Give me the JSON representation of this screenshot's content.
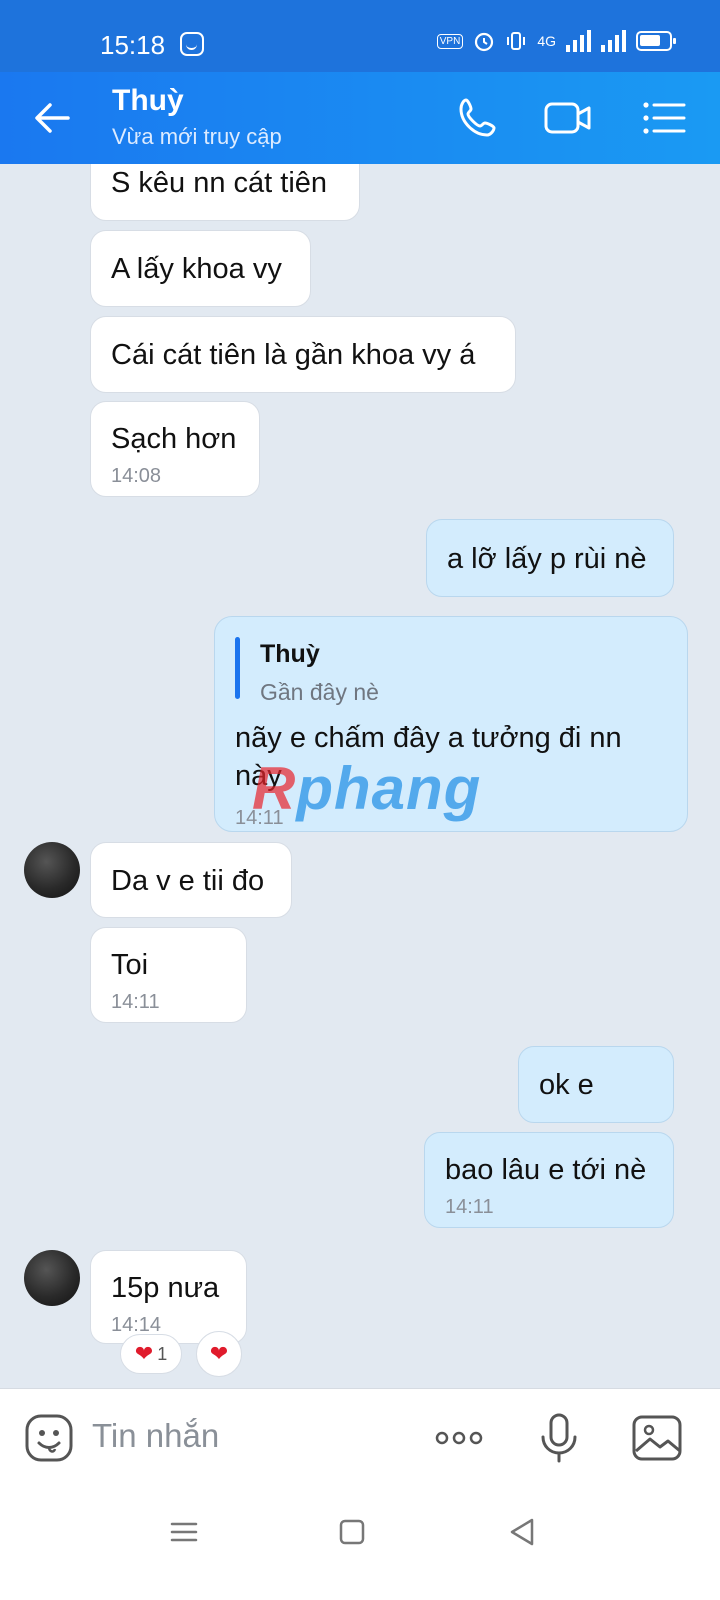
{
  "status_bar": {
    "time": "15:18",
    "network": "4G",
    "vpn": "VPN"
  },
  "header": {
    "contact_name": "Thuỳ",
    "contact_status": "Vừa mới truy cập"
  },
  "messages": [
    {
      "side": "in",
      "text": "S kêu nn cát tiên"
    },
    {
      "side": "in",
      "text": "A lấy khoa vy"
    },
    {
      "side": "in",
      "text": "Cái cát tiên là gần khoa vy á"
    },
    {
      "side": "in",
      "text": "Sạch hơn",
      "time": "14:08"
    },
    {
      "side": "out",
      "text": "a lỡ lấy p rùi nè"
    },
    {
      "side": "out",
      "quote_name": "Thuỳ",
      "quote_text": "Gần đây nè",
      "text": "nãy e chấm  đây a tưởng đi nn này",
      "time": "14:11"
    },
    {
      "side": "in",
      "text": "Da v e tii đo"
    },
    {
      "side": "in",
      "text": "Toi",
      "time": "14:11"
    },
    {
      "side": "out",
      "text": "ok e"
    },
    {
      "side": "out",
      "text": "bao lâu e tới nè",
      "time": "14:11"
    },
    {
      "side": "in",
      "text": "15p nưa",
      "time": "14:14"
    }
  ],
  "reactions": {
    "emoji": "❤",
    "count": "1"
  },
  "watermark": {
    "left": "R",
    "right": "phang"
  },
  "composer": {
    "placeholder": "Tin nhắn"
  },
  "colors": {
    "header": "#1a78f0",
    "status_bar": "#1e73dc",
    "outgoing_bubble": "#d3ecfd",
    "chat_background": "#e2e9f1",
    "accent": "#1b74ee"
  }
}
